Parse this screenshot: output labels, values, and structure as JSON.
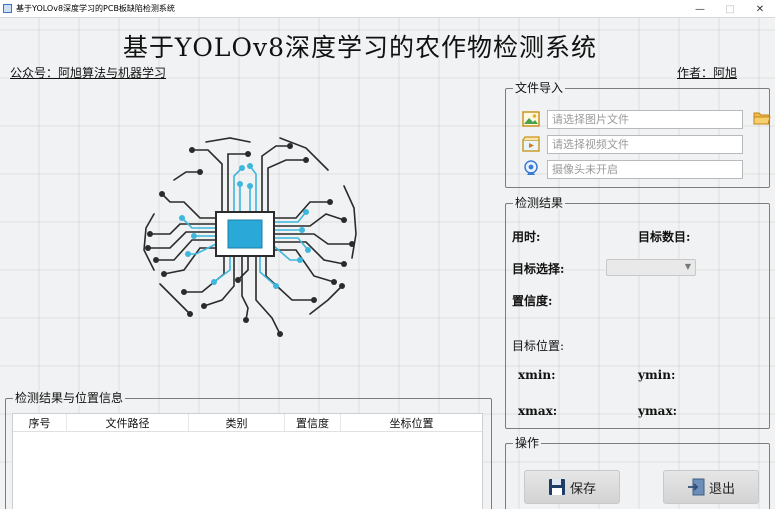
{
  "window": {
    "title": "基于YOLOv8深度学习的PCB板缺陷检测系统",
    "controls": [
      "—",
      "□",
      "✕"
    ]
  },
  "header": {
    "title": "基于YOLOv8深度学习的农作物检测系统",
    "account": "公众号：阿旭算法与机器学习",
    "author": "作者：阿旭"
  },
  "results_table": {
    "group_title": "检测结果与位置信息",
    "columns": [
      "序号",
      "文件路径",
      "类别",
      "置信度",
      "坐标位置"
    ]
  },
  "file_import": {
    "group_title": "文件导入",
    "image_placeholder": "请选择图片文件",
    "video_placeholder": "请选择视频文件",
    "camera_placeholder": "摄像头未开启",
    "icons": [
      "image-icon",
      "video-icon",
      "camera-icon",
      "folder-open-icon"
    ]
  },
  "detection_result": {
    "group_title": "检测结果",
    "time_label": "用时:",
    "count_label": "目标数目:",
    "target_select_label": "目标选择:",
    "confidence_label": "置信度:",
    "position_label": "目标位置:",
    "xmin_label": "xmin:",
    "ymin_label": "ymin:",
    "xmax_label": "xmax:",
    "ymax_label": "ymax:"
  },
  "operation": {
    "group_title": "操作",
    "save_label": "保存",
    "exit_label": "退出"
  },
  "colors": {
    "circuit_dark": "#2b2b2b",
    "circuit_accent": "#3fb7dc",
    "chip": "#2aa9d8"
  }
}
